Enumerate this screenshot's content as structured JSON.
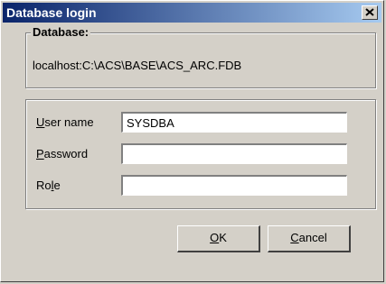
{
  "window": {
    "title": "Database login",
    "close_label": "×"
  },
  "database_group": {
    "label": "Database:",
    "path": "localhost:C:\\ACS\\BASE\\ACS_ARC.FDB"
  },
  "login": {
    "username": {
      "label_mnemonic": "U",
      "label_rest": "ser name",
      "value": "SYSDBA"
    },
    "password": {
      "label_mnemonic": "P",
      "label_rest": "assword",
      "value": ""
    },
    "role": {
      "label_pre": "Ro",
      "label_mnemonic": "l",
      "label_rest": "e",
      "value": ""
    }
  },
  "buttons": {
    "ok": {
      "mnemonic": "O",
      "rest": "K"
    },
    "cancel": {
      "mnemonic": "C",
      "rest": "ancel"
    }
  },
  "colors": {
    "title_start": "#0a246a",
    "title_end": "#a6caf0",
    "face": "#d4d0c8"
  }
}
